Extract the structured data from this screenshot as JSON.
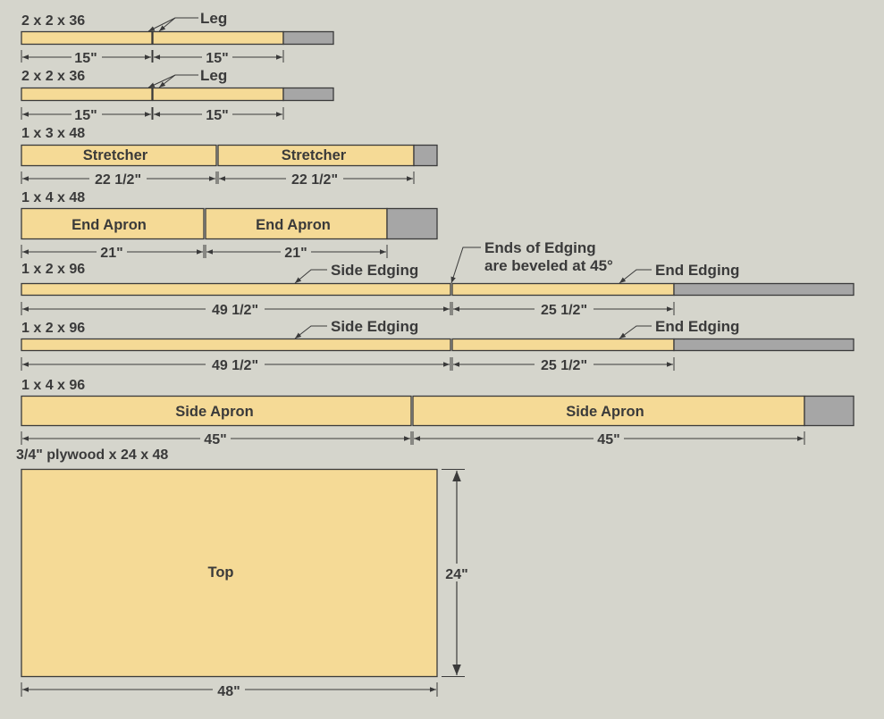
{
  "colors": {
    "background": "#d5d5cc",
    "wood": "#f5da96",
    "waste": "#a6a6a6",
    "outline": "#3a3a3a",
    "text": "#3a3a3a"
  },
  "boards": [
    {
      "stock": "2 x 2 x 36",
      "parts": [
        {
          "name": "",
          "dimension": "15\""
        },
        {
          "name": "",
          "dimension": "15\""
        }
      ],
      "callouts": [
        {
          "text": "Leg"
        }
      ]
    },
    {
      "stock": "2 x 2 x 36",
      "parts": [
        {
          "name": "",
          "dimension": "15\""
        },
        {
          "name": "",
          "dimension": "15\""
        }
      ],
      "callouts": [
        {
          "text": "Leg"
        }
      ]
    },
    {
      "stock": "1 x 3 x 48",
      "parts": [
        {
          "name": "Stretcher",
          "dimension": "22 1/2\""
        },
        {
          "name": "Stretcher",
          "dimension": "22 1/2\""
        }
      ],
      "callouts": []
    },
    {
      "stock": "1 x 4 x 48",
      "parts": [
        {
          "name": "End Apron",
          "dimension": "21\""
        },
        {
          "name": "End Apron",
          "dimension": "21\""
        }
      ],
      "callouts": []
    },
    {
      "stock": "1 x 2 x 96",
      "parts": [
        {
          "name": "",
          "dimension": "49 1/2\""
        },
        {
          "name": "",
          "dimension": "25 1/2\""
        }
      ],
      "callouts": [
        {
          "text": "Side Edging"
        },
        {
          "text": "End Edging"
        },
        {
          "text": "Ends of Edging",
          "text2": "are beveled at 45°"
        }
      ]
    },
    {
      "stock": "1 x 2 x 96",
      "parts": [
        {
          "name": "",
          "dimension": "49 1/2\""
        },
        {
          "name": "",
          "dimension": "25 1/2\""
        }
      ],
      "callouts": [
        {
          "text": "Side Edging"
        },
        {
          "text": "End Edging"
        }
      ]
    },
    {
      "stock": "1 x 4 x 96",
      "parts": [
        {
          "name": "Side Apron",
          "dimension": "45\""
        },
        {
          "name": "Side Apron",
          "dimension": "45\""
        }
      ],
      "callouts": []
    }
  ],
  "sheet": {
    "stock": "3/4\" plywood x 24 x 48",
    "part": "Top",
    "width_dimension": "48\"",
    "height_dimension": "24\""
  }
}
